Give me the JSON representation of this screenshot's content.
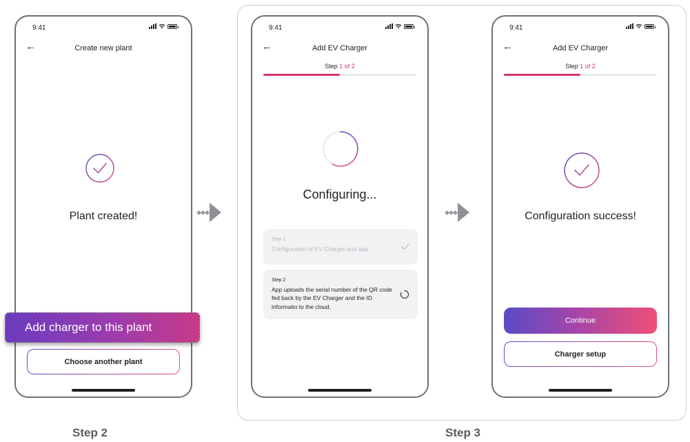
{
  "colors": {
    "accent": "#d6336c",
    "gradient_start": "#5a4bc6",
    "gradient_end": "#ee5077",
    "frame": "#6d6f73"
  },
  "screen1": {
    "time": "9:41",
    "title": "Create new plant",
    "message": "Plant created!",
    "secondary_button": "Choose another plant"
  },
  "callout": {
    "label": "Add charger  to this plant"
  },
  "screen2": {
    "time": "9:41",
    "title": "Add EV Charger",
    "step_prefix": "Step ",
    "step_value": "1 of 2",
    "progress": 0.5,
    "message": "Configuring...",
    "cards": [
      {
        "step": "Step 1",
        "text": "Configuration of EV Charger and app.",
        "state": "done"
      },
      {
        "step": "Step 2",
        "text": "App uploads the serial number of the QR code fed back by the EV Charger and the ID informatio to the cloud.",
        "state": "loading"
      }
    ]
  },
  "screen3": {
    "time": "9:41",
    "title": "Add EV Charger",
    "step_prefix": "Step ",
    "step_value": "1 of 2",
    "progress": 0.5,
    "message": "Configuration success!",
    "primary_button": "Continue",
    "secondary_button": "Charger setup"
  },
  "captions": {
    "left": "Step 2",
    "right": "Step 3"
  },
  "icons": [
    "back-arrow-icon",
    "check-circle-icon",
    "spinner-icon",
    "check-icon",
    "flow-arrow-icon",
    "signal-icon",
    "wifi-icon",
    "battery-icon"
  ]
}
